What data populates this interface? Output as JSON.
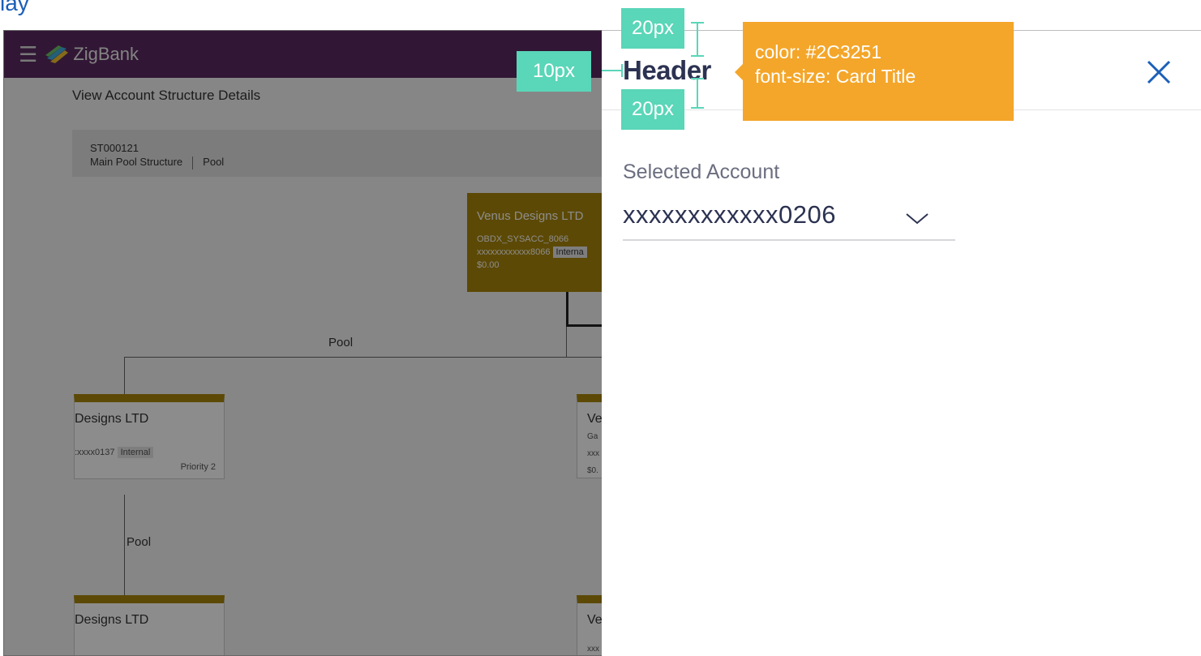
{
  "clip_title_fragment": "lay",
  "app": {
    "brand": "ZigBank",
    "page_title": "View Account Structure Details",
    "structure": {
      "id": "ST000121",
      "name": "Main Pool Structure",
      "type": "Pool"
    },
    "root_node": {
      "name": "Venus Designs LTD",
      "account_name": "OBDX_SYSACC_8066",
      "account_no": "xxxxxxxxxxxx8066",
      "badge": "Interna",
      "balance": "$0.00"
    },
    "pool_labels": [
      "Pool",
      "Pool"
    ],
    "child_nodes": [
      {
        "name": "Designs LTD",
        "account_no": ":xxxx0137",
        "badge": "Internal",
        "priority": "Priority 2"
      },
      {
        "name": "Designs LTD"
      }
    ],
    "right_nodes": [
      {
        "name": "Ve",
        "line1": "Ga",
        "line2": "xxx",
        "line3": "$0."
      },
      {
        "name": "Ve",
        "line1": "xxx"
      }
    ]
  },
  "drawer": {
    "header": "Header",
    "field_label": "Selected Account",
    "selected_value": "xxxxxxxxxxxx0206"
  },
  "redline": {
    "top_spacing": "20px",
    "bottom_spacing": "20px",
    "left_spacing": "10px",
    "spec_line1": "color: #2C3251",
    "spec_line2": "font-size: Card Title"
  },
  "colors": {
    "header_text": "#2C3251",
    "accent_blue": "#1b5fb8",
    "annotation_green": "#5ad6b8",
    "annotation_orange": "#f4a62a",
    "topbar": "#5a2a62",
    "node_gold": "#a8860a"
  }
}
